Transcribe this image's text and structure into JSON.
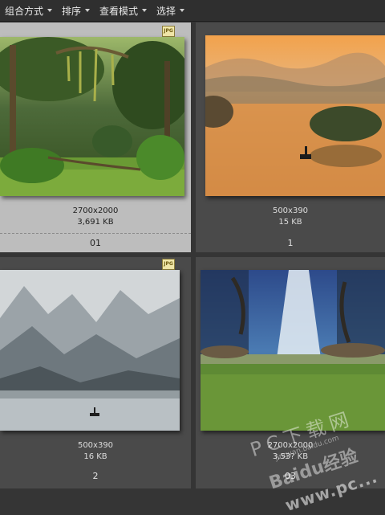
{
  "toolbar": {
    "menus": [
      {
        "label": "组合方式"
      },
      {
        "label": "排序"
      },
      {
        "label": "查看模式"
      },
      {
        "label": "选择"
      }
    ]
  },
  "items": [
    {
      "dimensions": "2700x2000",
      "size": "3,691 KB",
      "name": "01",
      "badge": "JPG",
      "selected": true
    },
    {
      "dimensions": "500x390",
      "size": "15 KB",
      "name": "1",
      "selected": false
    },
    {
      "dimensions": "500x390",
      "size": "16 KB",
      "name": "2",
      "badge": "JPG",
      "selected": false
    },
    {
      "dimensions": "2700x2000",
      "size": "3,53? KB",
      "name": "03",
      "selected": false
    }
  ],
  "watermark": {
    "brand": "Baidu经验",
    "site": "jingyan.baidu.com",
    "logo": "PC下载网",
    "url": "www.pc..."
  }
}
